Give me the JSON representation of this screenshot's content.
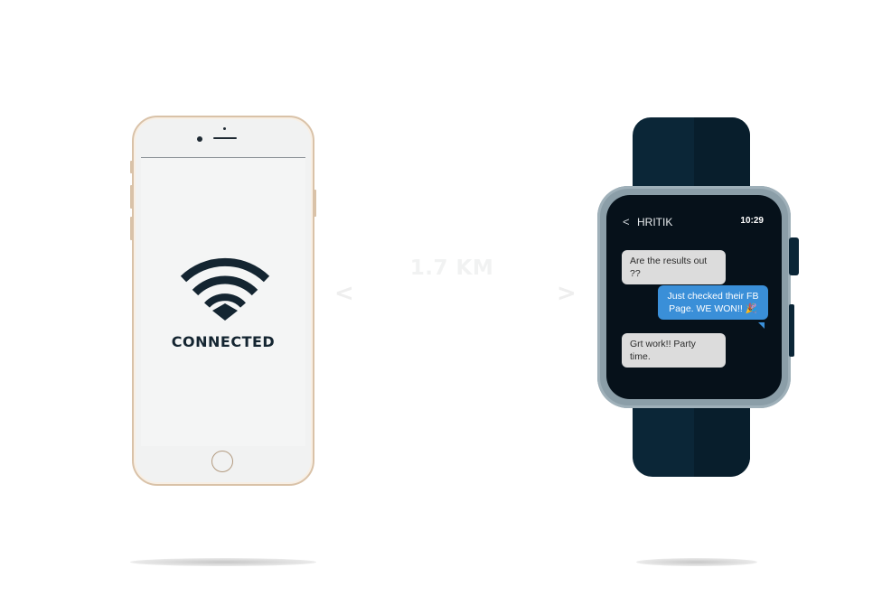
{
  "phone": {
    "status_text": "CONNECTED",
    "icon": "wifi-icon"
  },
  "link": {
    "distance": "1.7 KM",
    "left_arrow": "<",
    "right_arrow": ">"
  },
  "watch": {
    "back_icon": "<",
    "contact": "HRITIK",
    "time": "10:29",
    "messages": [
      {
        "direction": "incoming",
        "text": "Are the results out ??"
      },
      {
        "direction": "outgoing",
        "text": "Just checked their FB Page. WE WON!! 🎉"
      },
      {
        "direction": "incoming",
        "text": "Grt work!! Party time."
      }
    ]
  },
  "colors": {
    "navy": "#142531",
    "band": "#0b2637",
    "case": "#8b9ea8",
    "bubble_in": "#dcdcdc",
    "bubble_out": "#3a8fd8",
    "phone_gold": "#d9c2a8"
  }
}
